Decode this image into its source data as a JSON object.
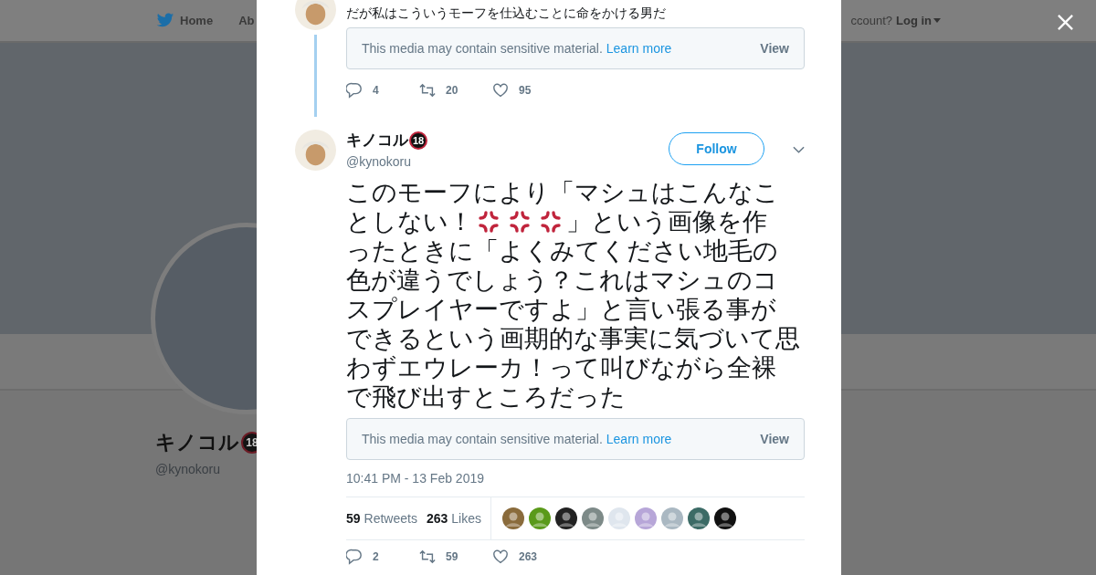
{
  "background": {
    "nav": {
      "home": "Home",
      "about": "Ab",
      "account_prompt": "ccount?",
      "login": "Log in"
    },
    "profile": {
      "name": "キノコル",
      "badge": "18",
      "handle": "@kynokoru"
    }
  },
  "modal": {
    "parent_tweet": {
      "text": "だが私はこういうモーフを仕込むことに命をかける男だ",
      "media_notice": {
        "text": "This media may contain sensitive material.",
        "link": "Learn more",
        "button": "View"
      },
      "actions": {
        "replies": "4",
        "retweets": "20",
        "likes": "95"
      }
    },
    "tweet": {
      "name": "キノコル",
      "badge": "18",
      "handle": "@kynokoru",
      "follow": "Follow",
      "body_lines": [
        [
          {
            "kind": "text",
            "text": "このモーフにより「マシュはこんなこ"
          }
        ],
        [
          {
            "kind": "text",
            "text": "としない！"
          },
          {
            "kind": "anger"
          },
          {
            "kind": "anger"
          },
          {
            "kind": "anger"
          },
          {
            "kind": "text",
            "text": "」という画像を作"
          }
        ],
        [
          {
            "kind": "text",
            "text": "ったときに「よくみてください地毛の"
          }
        ],
        [
          {
            "kind": "text",
            "text": "色が違うでしょう？これはマシュのコ"
          }
        ],
        [
          {
            "kind": "text",
            "text": "スプレイヤーですよ」と言い張る事が"
          }
        ],
        [
          {
            "kind": "text",
            "text": "できるという画期的な事実に気づいて思"
          }
        ],
        [
          {
            "kind": "text",
            "text": "わずエウレーカ！って叫びながら全裸"
          }
        ],
        [
          {
            "kind": "text",
            "text": "で飛び出すところだった"
          }
        ]
      ],
      "media_notice": {
        "text": "This media may contain sensitive material.",
        "link": "Learn more",
        "button": "View"
      },
      "time": "10:41 PM - 13 Feb 2019",
      "stats": {
        "retweets": "59",
        "retweets_label": "Retweets",
        "likes": "263",
        "likes_label": "Likes"
      },
      "actions": {
        "replies": "2",
        "retweets": "59",
        "likes": "263"
      }
    }
  }
}
